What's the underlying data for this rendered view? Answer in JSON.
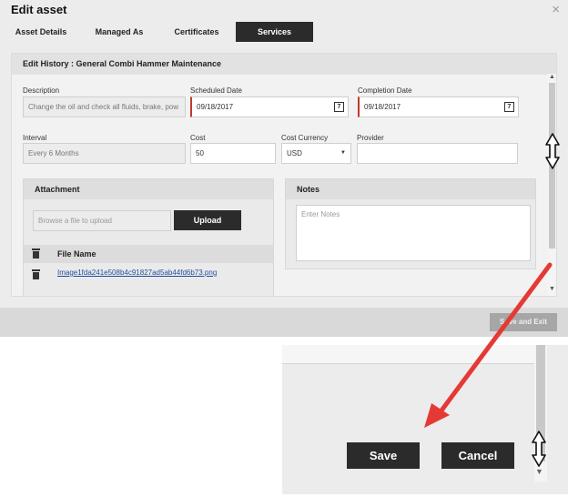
{
  "modal": {
    "title": "Edit asset",
    "close_icon": "×"
  },
  "tabs": [
    {
      "label": "Asset Details",
      "active": false
    },
    {
      "label": "Managed As",
      "active": false
    },
    {
      "label": "Certificates",
      "active": false
    },
    {
      "label": "Services",
      "active": true
    }
  ],
  "section": {
    "title": "Edit History : General Combi Hammer Maintenance"
  },
  "form": {
    "description": {
      "label": "Description",
      "value": "Change the oil and check all fluids, brake, pow"
    },
    "scheduled_date": {
      "label": "Scheduled Date",
      "value": "09/18/2017",
      "icon": "7"
    },
    "completion_date": {
      "label": "Completion Date",
      "value": "09/18/2017",
      "icon": "7"
    },
    "interval": {
      "label": "Interval",
      "value": "Every 6 Months"
    },
    "cost": {
      "label": "Cost",
      "value": "50"
    },
    "cost_currency": {
      "label": "Cost Currency",
      "value": "USD",
      "caret": "▼"
    },
    "provider": {
      "label": "Provider",
      "value": ""
    }
  },
  "attachment": {
    "title": "Attachment",
    "file_placeholder": "Browse a file to upload",
    "upload_label": "Upload",
    "file_name_header": "File Name",
    "files": [
      "Image1fda241e508b4c91827ad5ab44fd6b73.png"
    ]
  },
  "notes": {
    "title": "Notes",
    "placeholder": "Enter Notes"
  },
  "footer": {
    "save_exit_label": "Save and Exit"
  },
  "scrollbar": {
    "up_arrow": "▲",
    "down_arrow": "▼"
  },
  "inset": {
    "save_label": "Save",
    "cancel_label": "Cancel",
    "down_arrow": "▼"
  },
  "annotation": {
    "arrow_color": "#e53935",
    "resize_icon": "resize-vertical-icon"
  }
}
